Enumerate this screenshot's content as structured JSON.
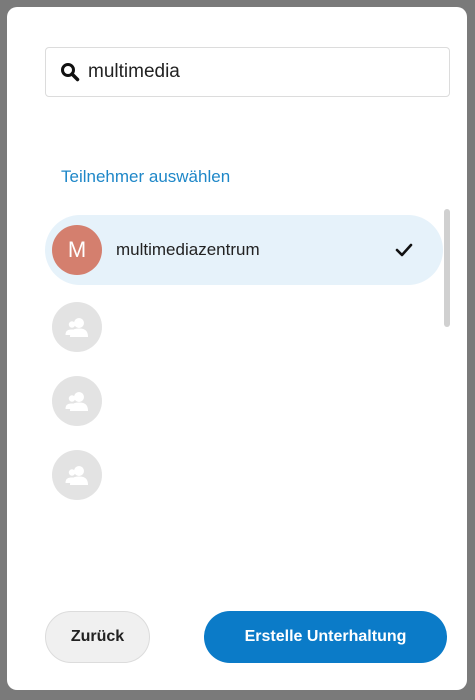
{
  "search": {
    "value": "multimedia",
    "icon": "search-icon"
  },
  "section": {
    "title": "Teilnehmer auswählen"
  },
  "participants": [
    {
      "initial": "M",
      "label": "multimediazentrum",
      "selected": true,
      "avatar_color": "#d47f6e"
    },
    {
      "initial": "",
      "label": "",
      "selected": false,
      "avatar_icon": "user-group-icon"
    },
    {
      "initial": "",
      "label": "",
      "selected": false,
      "avatar_icon": "user-group-icon"
    },
    {
      "initial": "",
      "label": "",
      "selected": false,
      "avatar_icon": "user-group-icon"
    }
  ],
  "buttons": {
    "back_label": "Zurück",
    "create_label": "Erstelle Unterhaltung"
  },
  "colors": {
    "accent": "#0b7bc8",
    "link": "#1e87c8",
    "selected_row": "#e6f2fa"
  }
}
